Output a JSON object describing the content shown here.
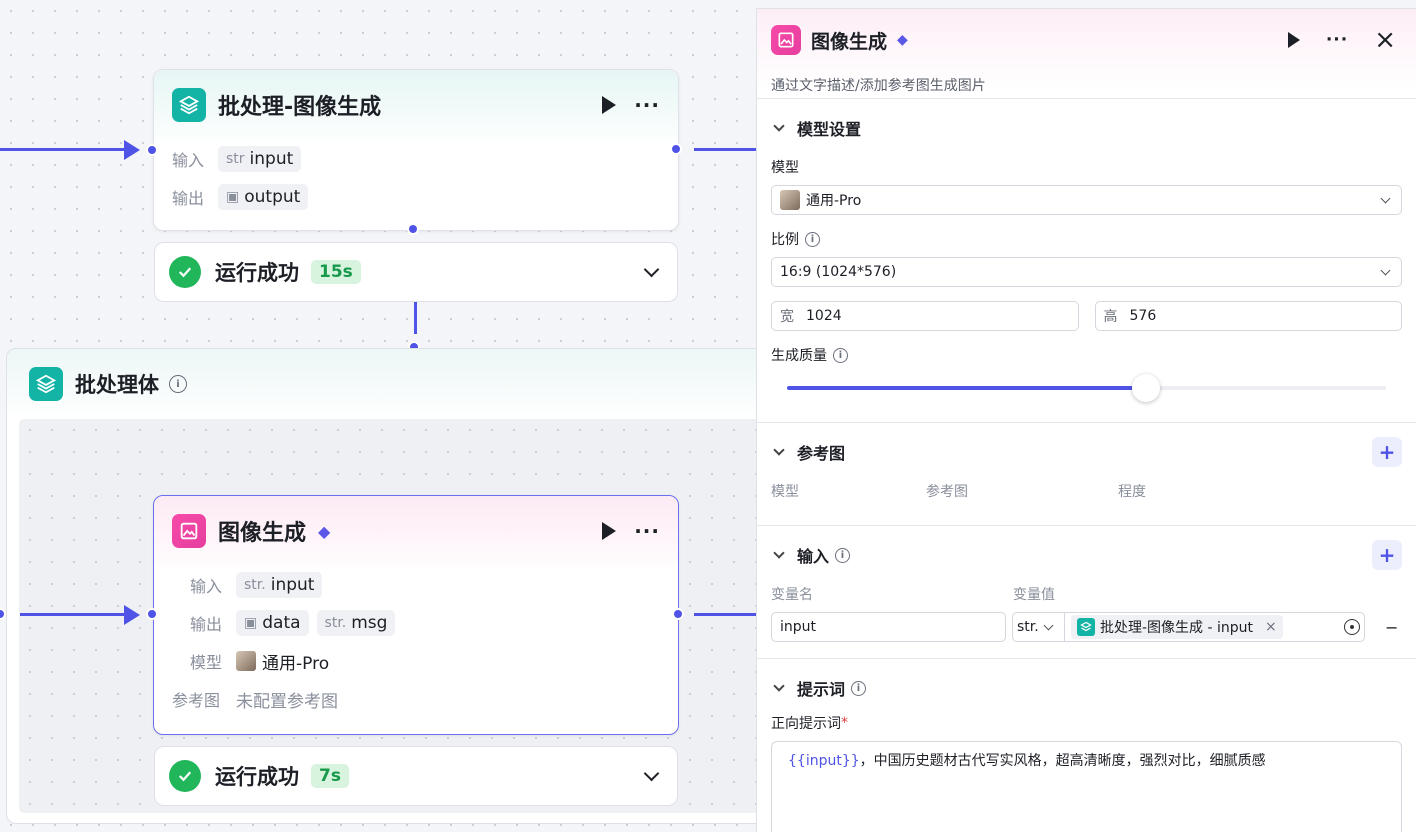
{
  "top_node": {
    "title": "批处理-图像生成",
    "input_label": "输入",
    "output_label": "输出",
    "input_type": "str",
    "input_name": "input",
    "output_name": "output",
    "status": "运行成功",
    "duration": "15s"
  },
  "group": {
    "title": "批处理体"
  },
  "inner_node": {
    "title": "图像生成",
    "input_label": "输入",
    "output_label": "输出",
    "model_label": "模型",
    "ref_label": "参考图",
    "input_type": "str.",
    "input_name": "input",
    "output_data": "data",
    "output_msg_type": "str.",
    "output_msg": "msg",
    "model_name": "通用-Pro",
    "ref_value": "未配置参考图",
    "status": "运行成功",
    "duration": "7s"
  },
  "panel": {
    "title": "图像生成",
    "subtitle": "通过文字描述/添加参考图生成图片",
    "model_section": {
      "heading": "模型设置",
      "model_label": "模型",
      "model_value": "通用-Pro",
      "ratio_label": "比例",
      "ratio_value": "16:9 (1024*576)",
      "width_label": "宽",
      "width_value": "1024",
      "height_label": "高",
      "height_value": "576",
      "quality_label": "生成质量",
      "quality_fraction": 0.6
    },
    "ref_section": {
      "heading": "参考图",
      "col_model": "模型",
      "col_ref": "参考图",
      "col_degree": "程度"
    },
    "input_section": {
      "heading": "输入",
      "col_name": "变量名",
      "col_value": "变量值",
      "var_name": "input",
      "var_type": "str.",
      "ref_text": "批处理-图像生成 - input",
      "remove": "−"
    },
    "prompt_section": {
      "heading": "提示词",
      "positive_label": "正向提示词",
      "required_mark": "*",
      "var_token": "{{input}}",
      "prompt_text": "，中国历史题材古代写实风格，超高清晰度，强烈对比，细腻质感"
    }
  },
  "colors": {
    "accent": "#4f54e6",
    "success": "#22b65a",
    "teal": "#13b3a6",
    "pink": "#e53d9f"
  }
}
